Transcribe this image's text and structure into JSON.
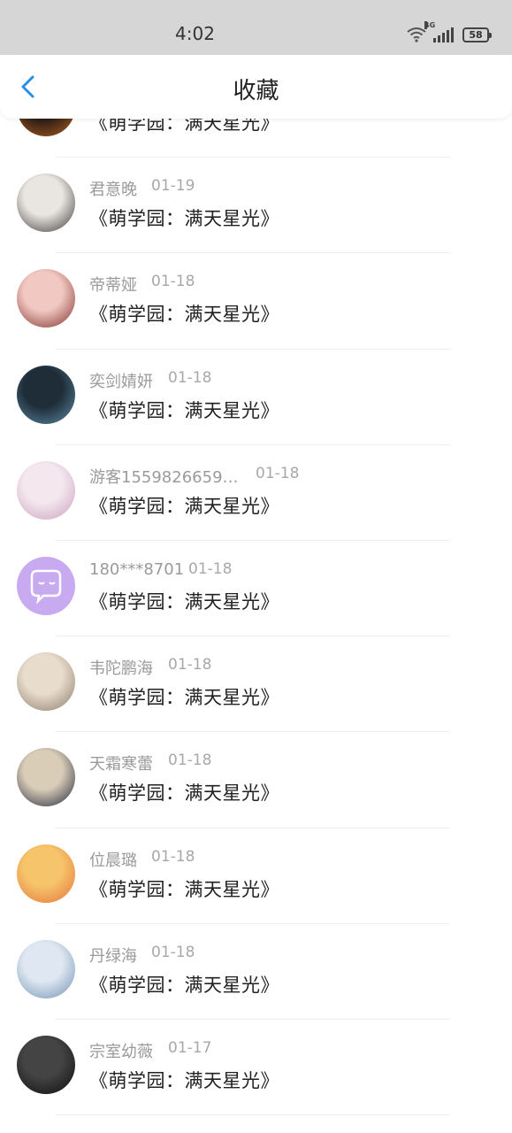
{
  "status_bar": {
    "time": "4:02",
    "network": "4G",
    "battery": "58"
  },
  "header": {
    "title": "收藏"
  },
  "items": [
    {
      "name": "",
      "date": "",
      "book": "《萌学园：满天星光》",
      "avatar_colors": [
        "#2a1c16",
        "#b5621f"
      ]
    },
    {
      "name": "君意晚",
      "date": "01-19",
      "book": "《萌学园：满天星光》",
      "avatar_colors": [
        "#e9e6e2",
        "#3b3533"
      ]
    },
    {
      "name": "帝蒂娅",
      "date": "01-18",
      "book": "《萌学园：满天星光》",
      "avatar_colors": [
        "#f2c8c2",
        "#7d2c26"
      ]
    },
    {
      "name": "奕剑婧妍",
      "date": "01-18",
      "book": "《萌学园：满天星光》",
      "avatar_colors": [
        "#1f2d38",
        "#5e8da8"
      ]
    },
    {
      "name": "游客1559826659…",
      "date": "01-18",
      "book": "《萌学园：满天星光》",
      "avatar_colors": [
        "#f4e8ee",
        "#c99fbd"
      ]
    },
    {
      "name": "180***8701",
      "date": "01-18",
      "book": "《萌学园：满天星光》",
      "avatar_colors": [
        "#c8aaf0",
        "#c8aaf0"
      ]
    },
    {
      "name": "韦陀鹏海",
      "date": "01-18",
      "book": "《萌学园：满天星光》",
      "avatar_colors": [
        "#e8dccd",
        "#8a7a66"
      ]
    },
    {
      "name": "天霜寒蕾",
      "date": "01-18",
      "book": "《萌学园：满天星光》",
      "avatar_colors": [
        "#d9cdb8",
        "#1e2236"
      ]
    },
    {
      "name": "位晨璐",
      "date": "01-18",
      "book": "《萌学园：满天星光》",
      "avatar_colors": [
        "#f6c46a",
        "#e6723b"
      ]
    },
    {
      "name": "丹绿海",
      "date": "01-18",
      "book": "《萌学园：满天星光》",
      "avatar_colors": [
        "#dfe8f2",
        "#6e8fb3"
      ]
    },
    {
      "name": "宗室幼薇",
      "date": "01-17",
      "book": "《萌学园：满天星光》",
      "avatar_colors": [
        "#444444",
        "#0b0b0b"
      ]
    }
  ],
  "colors": {
    "accent": "#2b8ee6",
    "name_text": "#9a9a9a",
    "book_text": "#222222"
  },
  "icons": {
    "back": "chevron-left-icon",
    "chat_avatar": "chat-bubble-icon"
  }
}
